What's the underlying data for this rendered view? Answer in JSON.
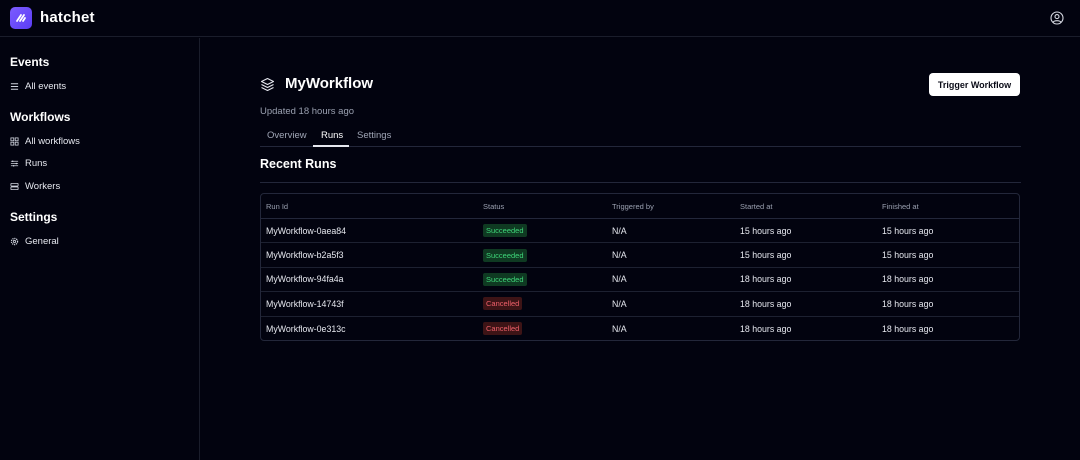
{
  "app": {
    "brand": "hatchet"
  },
  "sidebar": {
    "sections": [
      {
        "heading": "Events",
        "items": [
          {
            "label": "All events",
            "icon": "list-icon"
          }
        ]
      },
      {
        "heading": "Workflows",
        "items": [
          {
            "label": "All workflows",
            "icon": "grid-icon"
          },
          {
            "label": "Runs",
            "icon": "sliders-icon"
          },
          {
            "label": "Workers",
            "icon": "server-icon"
          }
        ]
      },
      {
        "heading": "Settings",
        "items": [
          {
            "label": "General",
            "icon": "gear-icon"
          }
        ]
      }
    ]
  },
  "workflow": {
    "title": "MyWorkflow",
    "updated": "Updated 18 hours ago",
    "trigger_label": "Trigger Workflow",
    "tabs": [
      {
        "label": "Overview",
        "active": false
      },
      {
        "label": "Runs",
        "active": true
      },
      {
        "label": "Settings",
        "active": false
      }
    ]
  },
  "runs": {
    "title": "Recent Runs",
    "columns": [
      "Run Id",
      "Status",
      "Triggered by",
      "Started at",
      "Finished at"
    ],
    "rows": [
      {
        "id": "MyWorkflow-0aea84",
        "status": "Succeeded",
        "status_kind": "ok",
        "triggered_by": "N/A",
        "started": "15 hours ago",
        "finished": "15 hours ago"
      },
      {
        "id": "MyWorkflow-b2a5f3",
        "status": "Succeeded",
        "status_kind": "ok",
        "triggered_by": "N/A",
        "started": "15 hours ago",
        "finished": "15 hours ago"
      },
      {
        "id": "MyWorkflow-94fa4a",
        "status": "Succeeded",
        "status_kind": "ok",
        "triggered_by": "N/A",
        "started": "18 hours ago",
        "finished": "18 hours ago"
      },
      {
        "id": "MyWorkflow-14743f",
        "status": "Cancelled",
        "status_kind": "bad",
        "triggered_by": "N/A",
        "started": "18 hours ago",
        "finished": "18 hours ago"
      },
      {
        "id": "MyWorkflow-0e313c",
        "status": "Cancelled",
        "status_kind": "bad",
        "triggered_by": "N/A",
        "started": "18 hours ago",
        "finished": "18 hours ago"
      }
    ]
  },
  "colors": {
    "background": "#02030f",
    "accent": "#6d4cff",
    "success": "#3fd77a",
    "danger": "#f0606a"
  }
}
